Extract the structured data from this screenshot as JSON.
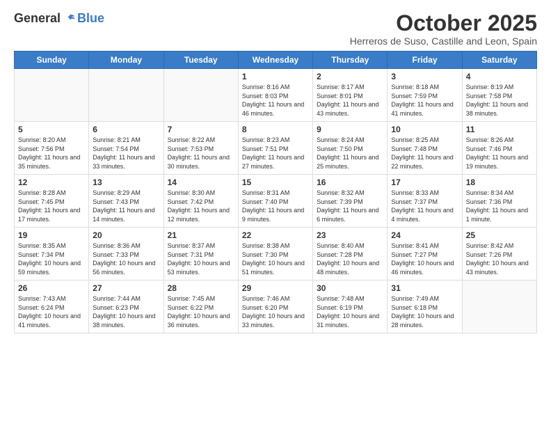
{
  "logo": {
    "general": "General",
    "blue": "Blue"
  },
  "header": {
    "title": "October 2025",
    "subtitle": "Herreros de Suso, Castille and Leon, Spain"
  },
  "days_of_week": [
    "Sunday",
    "Monday",
    "Tuesday",
    "Wednesday",
    "Thursday",
    "Friday",
    "Saturday"
  ],
  "weeks": [
    [
      {
        "day": "",
        "sunrise": "",
        "sunset": "",
        "daylight": ""
      },
      {
        "day": "",
        "sunrise": "",
        "sunset": "",
        "daylight": ""
      },
      {
        "day": "",
        "sunrise": "",
        "sunset": "",
        "daylight": ""
      },
      {
        "day": "1",
        "sunrise": "Sunrise: 8:16 AM",
        "sunset": "Sunset: 8:03 PM",
        "daylight": "Daylight: 11 hours and 46 minutes."
      },
      {
        "day": "2",
        "sunrise": "Sunrise: 8:17 AM",
        "sunset": "Sunset: 8:01 PM",
        "daylight": "Daylight: 11 hours and 43 minutes."
      },
      {
        "day": "3",
        "sunrise": "Sunrise: 8:18 AM",
        "sunset": "Sunset: 7:59 PM",
        "daylight": "Daylight: 11 hours and 41 minutes."
      },
      {
        "day": "4",
        "sunrise": "Sunrise: 8:19 AM",
        "sunset": "Sunset: 7:58 PM",
        "daylight": "Daylight: 11 hours and 38 minutes."
      }
    ],
    [
      {
        "day": "5",
        "sunrise": "Sunrise: 8:20 AM",
        "sunset": "Sunset: 7:56 PM",
        "daylight": "Daylight: 11 hours and 35 minutes."
      },
      {
        "day": "6",
        "sunrise": "Sunrise: 8:21 AM",
        "sunset": "Sunset: 7:54 PM",
        "daylight": "Daylight: 11 hours and 33 minutes."
      },
      {
        "day": "7",
        "sunrise": "Sunrise: 8:22 AM",
        "sunset": "Sunset: 7:53 PM",
        "daylight": "Daylight: 11 hours and 30 minutes."
      },
      {
        "day": "8",
        "sunrise": "Sunrise: 8:23 AM",
        "sunset": "Sunset: 7:51 PM",
        "daylight": "Daylight: 11 hours and 27 minutes."
      },
      {
        "day": "9",
        "sunrise": "Sunrise: 8:24 AM",
        "sunset": "Sunset: 7:50 PM",
        "daylight": "Daylight: 11 hours and 25 minutes."
      },
      {
        "day": "10",
        "sunrise": "Sunrise: 8:25 AM",
        "sunset": "Sunset: 7:48 PM",
        "daylight": "Daylight: 11 hours and 22 minutes."
      },
      {
        "day": "11",
        "sunrise": "Sunrise: 8:26 AM",
        "sunset": "Sunset: 7:46 PM",
        "daylight": "Daylight: 11 hours and 19 minutes."
      }
    ],
    [
      {
        "day": "12",
        "sunrise": "Sunrise: 8:28 AM",
        "sunset": "Sunset: 7:45 PM",
        "daylight": "Daylight: 11 hours and 17 minutes."
      },
      {
        "day": "13",
        "sunrise": "Sunrise: 8:29 AM",
        "sunset": "Sunset: 7:43 PM",
        "daylight": "Daylight: 11 hours and 14 minutes."
      },
      {
        "day": "14",
        "sunrise": "Sunrise: 8:30 AM",
        "sunset": "Sunset: 7:42 PM",
        "daylight": "Daylight: 11 hours and 12 minutes."
      },
      {
        "day": "15",
        "sunrise": "Sunrise: 8:31 AM",
        "sunset": "Sunset: 7:40 PM",
        "daylight": "Daylight: 11 hours and 9 minutes."
      },
      {
        "day": "16",
        "sunrise": "Sunrise: 8:32 AM",
        "sunset": "Sunset: 7:39 PM",
        "daylight": "Daylight: 11 hours and 6 minutes."
      },
      {
        "day": "17",
        "sunrise": "Sunrise: 8:33 AM",
        "sunset": "Sunset: 7:37 PM",
        "daylight": "Daylight: 11 hours and 4 minutes."
      },
      {
        "day": "18",
        "sunrise": "Sunrise: 8:34 AM",
        "sunset": "Sunset: 7:36 PM",
        "daylight": "Daylight: 11 hours and 1 minute."
      }
    ],
    [
      {
        "day": "19",
        "sunrise": "Sunrise: 8:35 AM",
        "sunset": "Sunset: 7:34 PM",
        "daylight": "Daylight: 10 hours and 59 minutes."
      },
      {
        "day": "20",
        "sunrise": "Sunrise: 8:36 AM",
        "sunset": "Sunset: 7:33 PM",
        "daylight": "Daylight: 10 hours and 56 minutes."
      },
      {
        "day": "21",
        "sunrise": "Sunrise: 8:37 AM",
        "sunset": "Sunset: 7:31 PM",
        "daylight": "Daylight: 10 hours and 53 minutes."
      },
      {
        "day": "22",
        "sunrise": "Sunrise: 8:38 AM",
        "sunset": "Sunset: 7:30 PM",
        "daylight": "Daylight: 10 hours and 51 minutes."
      },
      {
        "day": "23",
        "sunrise": "Sunrise: 8:40 AM",
        "sunset": "Sunset: 7:28 PM",
        "daylight": "Daylight: 10 hours and 48 minutes."
      },
      {
        "day": "24",
        "sunrise": "Sunrise: 8:41 AM",
        "sunset": "Sunset: 7:27 PM",
        "daylight": "Daylight: 10 hours and 46 minutes."
      },
      {
        "day": "25",
        "sunrise": "Sunrise: 8:42 AM",
        "sunset": "Sunset: 7:26 PM",
        "daylight": "Daylight: 10 hours and 43 minutes."
      }
    ],
    [
      {
        "day": "26",
        "sunrise": "Sunrise: 7:43 AM",
        "sunset": "Sunset: 6:24 PM",
        "daylight": "Daylight: 10 hours and 41 minutes."
      },
      {
        "day": "27",
        "sunrise": "Sunrise: 7:44 AM",
        "sunset": "Sunset: 6:23 PM",
        "daylight": "Daylight: 10 hours and 38 minutes."
      },
      {
        "day": "28",
        "sunrise": "Sunrise: 7:45 AM",
        "sunset": "Sunset: 6:22 PM",
        "daylight": "Daylight: 10 hours and 36 minutes."
      },
      {
        "day": "29",
        "sunrise": "Sunrise: 7:46 AM",
        "sunset": "Sunset: 6:20 PM",
        "daylight": "Daylight: 10 hours and 33 minutes."
      },
      {
        "day": "30",
        "sunrise": "Sunrise: 7:48 AM",
        "sunset": "Sunset: 6:19 PM",
        "daylight": "Daylight: 10 hours and 31 minutes."
      },
      {
        "day": "31",
        "sunrise": "Sunrise: 7:49 AM",
        "sunset": "Sunset: 6:18 PM",
        "daylight": "Daylight: 10 hours and 28 minutes."
      },
      {
        "day": "",
        "sunrise": "",
        "sunset": "",
        "daylight": ""
      }
    ]
  ]
}
